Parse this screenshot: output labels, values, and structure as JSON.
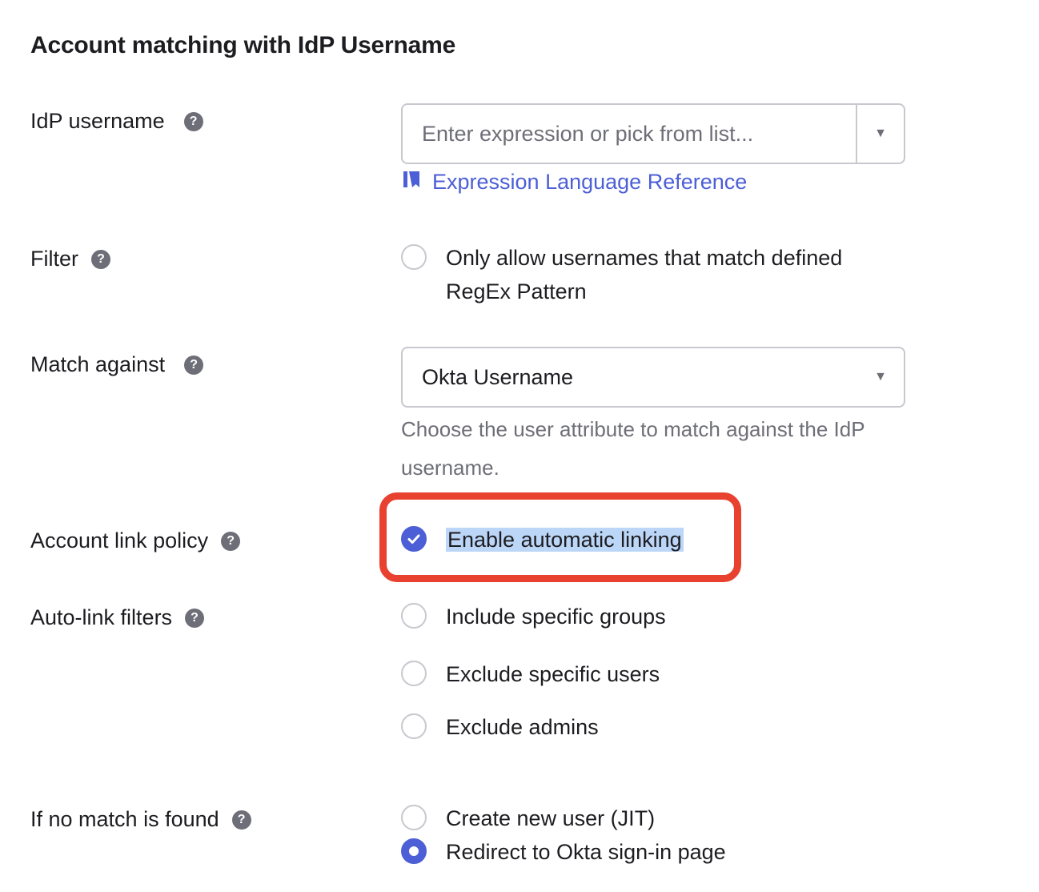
{
  "section": {
    "title": "Account matching with IdP Username"
  },
  "idp_username": {
    "label": "IdP username",
    "input_value": "",
    "placeholder": "Enter expression or pick from list...",
    "link_label": "Expression Language Reference"
  },
  "filter": {
    "label": "Filter",
    "checkbox_label_line1": "Only allow usernames that match defined",
    "checkbox_label_line2": "RegEx Pattern",
    "checked": false
  },
  "match_against": {
    "label": "Match against",
    "selected": "Okta Username",
    "hint": "Choose the user attribute to match against the IdP username."
  },
  "account_link_policy": {
    "label": "Account link policy",
    "checkbox_label": "Enable automatic linking",
    "checked": true
  },
  "auto_link_filters": {
    "label": "Auto-link filters",
    "options": [
      {
        "label": "Include specific groups",
        "checked": false
      },
      {
        "label": "Exclude specific users",
        "checked": false
      },
      {
        "label": "Exclude admins",
        "checked": false
      }
    ]
  },
  "no_match": {
    "label": "If no match is found",
    "options": [
      {
        "label": "Create new user (JIT)",
        "selected": false
      },
      {
        "label": "Redirect to Okta sign-in page",
        "selected": true
      }
    ]
  },
  "icons": {
    "help": "help-circle-icon",
    "book": "book-icon",
    "caret": "caret-down-icon",
    "check": "check-icon"
  },
  "colors": {
    "accent": "#4c5fd6",
    "callout": "#e8412f",
    "selection_highlight": "#bcd6f7"
  }
}
